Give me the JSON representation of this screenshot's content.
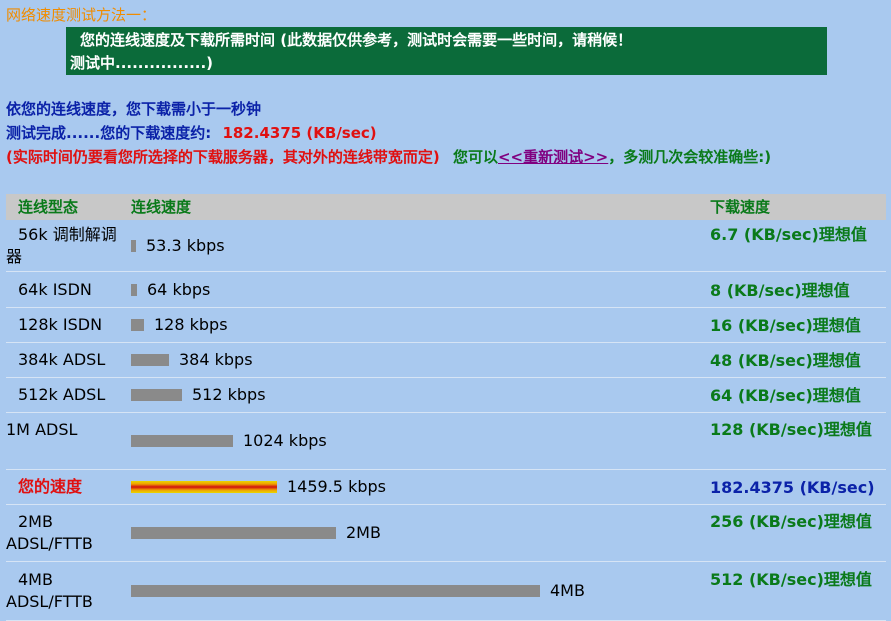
{
  "title": "网络速度测试方法一：",
  "notice": {
    "line1": "您的连线速度及下载所需时间 (此数据仅供参考，测试时会需要一些时间，请稍候！",
    "line2": "测试中................)"
  },
  "result": {
    "under_one_second": "依您的连线速度，您下载需小于一秒钟",
    "done_prefix": "测试完成......您的下载速度约:",
    "download_speed": "182.4375 (KB/sec)",
    "note_red": "(实际时间仍要看您所选择的下载服务器，其对外的连线带宽而定)",
    "note_green_1": "您可以",
    "retest_link": "<<重新测试>>",
    "note_green_2": "，多测几次会较准确些:)"
  },
  "table": {
    "headers": [
      "连线型态",
      "连线速度",
      "下载速度"
    ],
    "rows": [
      {
        "type": "56k 调制解调器",
        "speed": "53.3 kbps",
        "ideal": "6.7  (KB/sec)理想值",
        "kbps": 53.3,
        "highlight": false
      },
      {
        "type": "64k ISDN",
        "speed": "64 kbps",
        "ideal": "8  (KB/sec)理想值",
        "kbps": 64,
        "highlight": false
      },
      {
        "type": "128k ISDN",
        "speed": "128 kbps",
        "ideal": "16  (KB/sec)理想值",
        "kbps": 128,
        "highlight": false
      },
      {
        "type": "384k ADSL",
        "speed": "384 kbps",
        "ideal": "48  (KB/sec)理想值",
        "kbps": 384,
        "highlight": false
      },
      {
        "type": "512k ADSL",
        "speed": "512 kbps",
        "ideal": "64  (KB/sec)理想值",
        "kbps": 512,
        "highlight": false
      },
      {
        "type": "1M ADSL",
        "speed": "1024 kbps",
        "ideal": "128  (KB/sec)理想值",
        "kbps": 1024,
        "highlight": false
      },
      {
        "type": "您的速度",
        "speed": "1459.5 kbps",
        "ideal": "182.4375  (KB/sec)",
        "kbps": 1459.5,
        "highlight": true
      },
      {
        "type": "2MB ADSL/FTTB",
        "speed": "2MB",
        "ideal": "256  (KB/sec)理想值",
        "kbps": 2048,
        "highlight": false
      },
      {
        "type": "4MB ADSL/FTTB",
        "speed": "4MB",
        "ideal": "512  (KB/sec)理想值",
        "kbps": 4096,
        "highlight": false
      }
    ]
  },
  "colors": {
    "background": "#a9c9ef",
    "title": "#f08c00",
    "notice_bg": "#0b6b3a",
    "blue_text": "#0b22a8",
    "red_text": "#e01010",
    "green_text": "#0a7a1a",
    "link": "#800080",
    "bar": "#8a8a8a"
  }
}
